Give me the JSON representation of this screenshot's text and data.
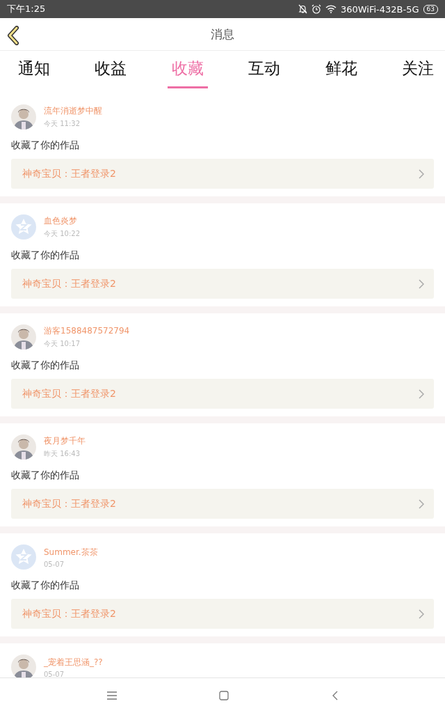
{
  "status_bar": {
    "time": "下午1:25",
    "network": "360WiFi-432B-5G",
    "battery": "63"
  },
  "header": {
    "title": "消息"
  },
  "tabs": [
    {
      "label": "通知",
      "selected": false
    },
    {
      "label": "收益",
      "selected": false
    },
    {
      "label": "收藏",
      "selected": true
    },
    {
      "label": "互动",
      "selected": false
    },
    {
      "label": "鲜花",
      "selected": false
    },
    {
      "label": "关注",
      "selected": false
    }
  ],
  "messages": [
    {
      "name": "流年消逝梦中醒",
      "time": "今天 11:32",
      "action": "收藏了你的作品",
      "work": "神奇宝贝：王者登录2"
    },
    {
      "avatar": {
        "kind": "default"
      },
      "name": "血色炎梦",
      "time": "今天 10:22",
      "action": "收藏了你的作品",
      "work": "神奇宝贝：王者登录2"
    },
    {
      "name": "游客1588487572794",
      "time": "今天 10:17",
      "action": "收藏了你的作品",
      "work": "神奇宝贝：王者登录2"
    },
    {
      "name": "夜月梦千年",
      "time": "昨天 16:43",
      "action": "收藏了你的作品",
      "work": "神奇宝贝：王者登录2"
    },
    {
      "avatar": {
        "kind": "default"
      },
      "name": "Summer.茶茶",
      "time": "05-07",
      "action": "收藏了你的作品",
      "work": "神奇宝贝：王者登录2"
    },
    {
      "name": "_宠着王思涵_??",
      "time": "05-07"
    }
  ]
}
